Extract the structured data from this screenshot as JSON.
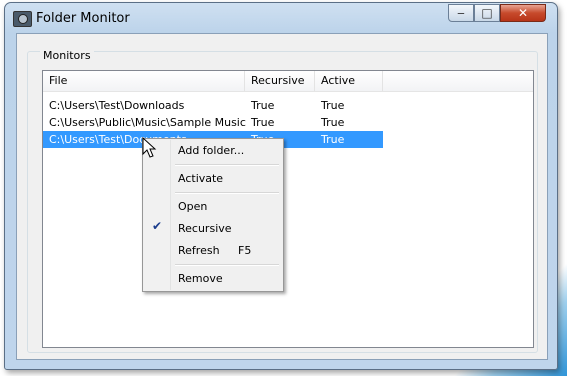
{
  "window": {
    "title": "Folder Monitor",
    "controls": {
      "minimize": "‒",
      "maximize": "□",
      "close": "✕"
    }
  },
  "group": {
    "label": "Monitors"
  },
  "table": {
    "columns": [
      "File",
      "Recursive",
      "Active"
    ],
    "rows": [
      {
        "file": "C:\\Users\\Test\\Downloads",
        "recursive": "True",
        "active": "True",
        "selected": false
      },
      {
        "file": "C:\\Users\\Public\\Music\\Sample Music",
        "recursive": "True",
        "active": "True",
        "selected": false
      },
      {
        "file": "C:\\Users\\Test\\Documents",
        "recursive": "True",
        "active": "True",
        "selected": true
      }
    ]
  },
  "context_menu": {
    "items": [
      {
        "label": "Add folder...",
        "checked": false
      },
      {
        "label": "Activate",
        "checked": false
      },
      {
        "label": "Open",
        "checked": false
      },
      {
        "label": "Recursive",
        "checked": true,
        "check_mark": "✔"
      },
      {
        "label": "Refresh",
        "shortcut": "F5",
        "checked": false
      },
      {
        "label": "Remove",
        "checked": false
      }
    ]
  },
  "colors": {
    "selection": "#3399ff",
    "title_bar": "#bcd3ea",
    "close_button": "#c74a2c"
  },
  "icons": {
    "app": "folder-monitor-app-icon",
    "cursor": "mouse-pointer-icon"
  }
}
